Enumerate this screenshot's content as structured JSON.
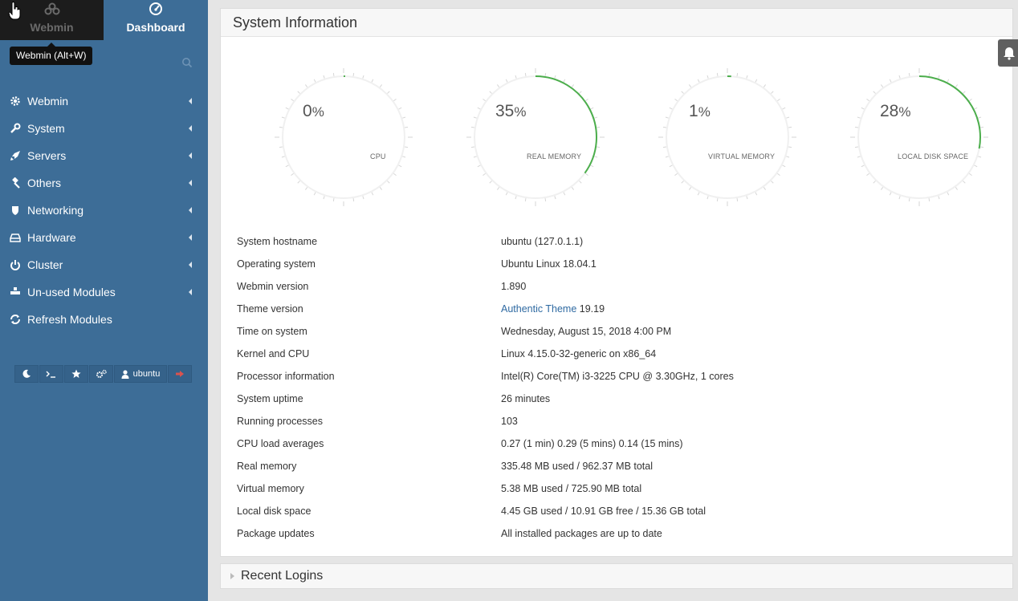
{
  "sidebar": {
    "tabs": [
      {
        "label": "Webmin",
        "icon": "webmin-logo-icon",
        "active": false
      },
      {
        "label": "Dashboard",
        "icon": "dashboard-gauge-icon",
        "active": true
      }
    ],
    "tooltip": "Webmin (Alt+W)",
    "search_icon": "search-icon",
    "menu": [
      {
        "label": "Webmin",
        "icon": "gear-icon"
      },
      {
        "label": "System",
        "icon": "wrench-icon"
      },
      {
        "label": "Servers",
        "icon": "rocket-icon"
      },
      {
        "label": "Others",
        "icon": "gavel-icon"
      },
      {
        "label": "Networking",
        "icon": "shield-icon"
      },
      {
        "label": "Hardware",
        "icon": "hdd-icon"
      },
      {
        "label": "Cluster",
        "icon": "power-icon"
      },
      {
        "label": "Un-used Modules",
        "icon": "puzzle-icon"
      },
      {
        "label": "Refresh Modules",
        "icon": "refresh-icon"
      }
    ],
    "bottom_bar": {
      "user": "ubuntu",
      "icons": [
        "moon-icon",
        "terminal-icon",
        "star-icon",
        "cogs-icon",
        "user-icon",
        "logout-icon"
      ]
    }
  },
  "system_info": {
    "title": "System Information",
    "gauges": [
      {
        "label": "CPU",
        "value": 0,
        "display": "0"
      },
      {
        "label": "REAL MEMORY",
        "value": 35,
        "display": "35"
      },
      {
        "label": "VIRTUAL MEMORY",
        "value": 1,
        "display": "1"
      },
      {
        "label": "LOCAL DISK SPACE",
        "value": 28,
        "display": "28"
      }
    ],
    "percent_sign": "%",
    "rows": [
      {
        "key": "System hostname",
        "value": "ubuntu (127.0.1.1)",
        "link": true
      },
      {
        "key": "Operating system",
        "value": "Ubuntu Linux 18.04.1"
      },
      {
        "key": "Webmin version",
        "value": "1.890"
      },
      {
        "key": "Theme version",
        "link_text": "Authentic Theme",
        "value_suffix": " 19.19"
      },
      {
        "key": "Time on system",
        "value": "Wednesday, August 15, 2018 4:00 PM",
        "link": true
      },
      {
        "key": "Kernel and CPU",
        "value": "Linux 4.15.0-32-generic on x86_64"
      },
      {
        "key": "Processor information",
        "value": "Intel(R) Core(TM) i3-3225 CPU @ 3.30GHz, 1 cores"
      },
      {
        "key": "System uptime",
        "value": "26 minutes",
        "link": true
      },
      {
        "key": "Running processes",
        "value": "103",
        "link": true
      },
      {
        "key": "CPU load averages",
        "value": "0.27 (1 min) 0.29 (5 mins) 0.14 (15 mins)"
      },
      {
        "key": "Real memory",
        "value": "335.48 MB used / 962.37 MB total"
      },
      {
        "key": "Virtual memory",
        "value": "5.38 MB used / 725.90 MB total"
      },
      {
        "key": "Local disk space",
        "value": "4.45 GB used / 10.91 GB free / 15.36 GB total"
      },
      {
        "key": "Package updates",
        "value": "All installed packages are up to date",
        "link": true
      }
    ]
  },
  "recent_logins": {
    "title": "Recent Logins"
  },
  "colors": {
    "sidebar": "#3d6d97",
    "gauge_fill": "#4cae4c",
    "link": "#2f6aa2"
  }
}
